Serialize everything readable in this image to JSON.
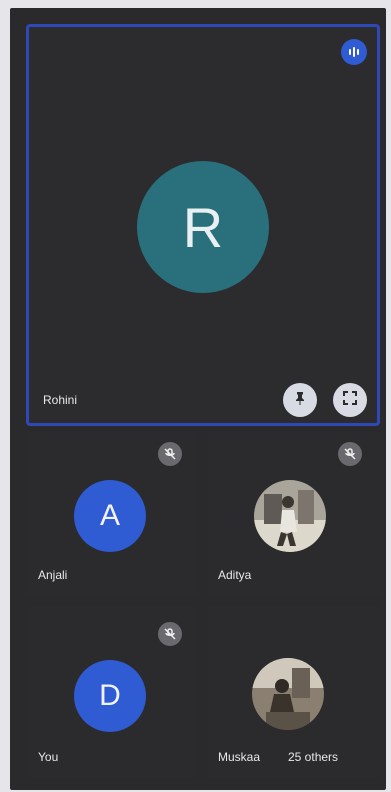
{
  "speaker": {
    "initial": "R",
    "name": "Rohini"
  },
  "participants": [
    {
      "initial": "A",
      "name": "Anjali"
    },
    {
      "name": "Aditya"
    },
    {
      "initial": "D",
      "name": "You"
    },
    {
      "name": "Muskaa",
      "others": "25 others"
    }
  ],
  "colors": {
    "accent": "#2f48b8",
    "avatar_R": "#2a6f7c",
    "avatar_blue": "#2f5bd3"
  },
  "icons": [
    "audio-level-icon",
    "pin-icon",
    "fullscreen-icon",
    "mic-off-icon"
  ]
}
